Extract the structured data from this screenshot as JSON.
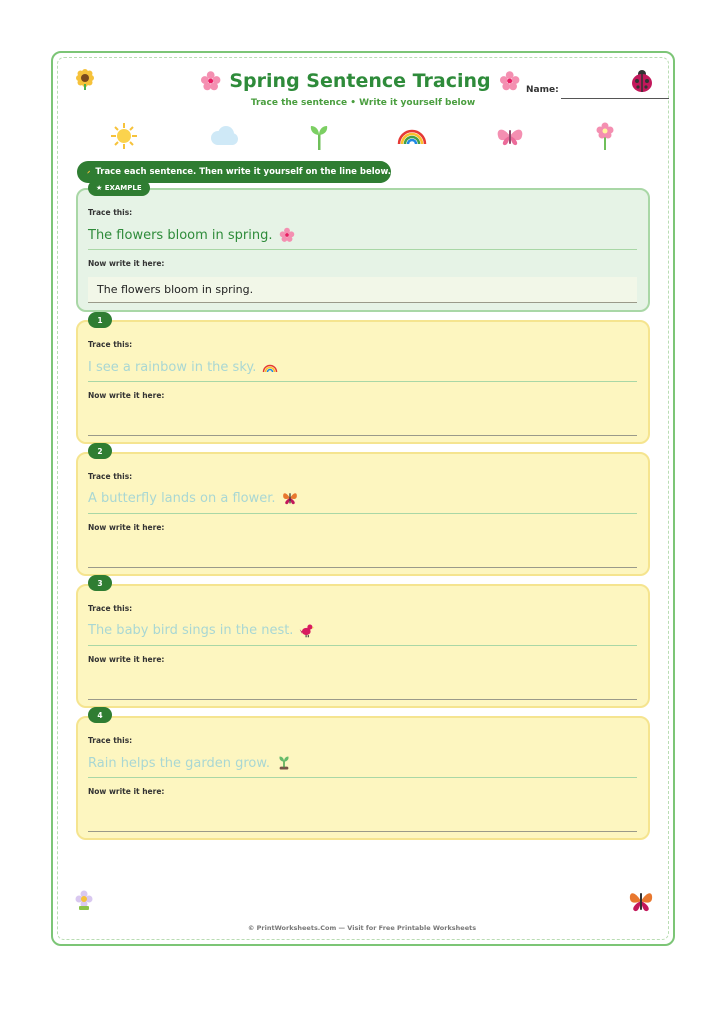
{
  "header": {
    "title": "Spring Sentence Tracing",
    "subtitle": "Trace the sentence • Write it yourself below",
    "name_label": "Name:"
  },
  "decorations": [
    "sun-icon",
    "cloud-icon",
    "sprout-icon",
    "rainbow-icon",
    "butterfly-icon",
    "flower-icon"
  ],
  "instructions": "Trace each sentence. Then write it yourself on the line below.",
  "example": {
    "badge": "★ EXAMPLE",
    "trace_label": "Trace this:",
    "sentence": "The flowers bloom in spring.",
    "write_label": "Now write it here:",
    "written": "The flowers bloom in spring."
  },
  "items": [
    {
      "number": "1",
      "trace_label": "Trace this:",
      "sentence": "I see a rainbow in the sky.",
      "icon": "rainbow-icon",
      "write_label": "Now write it here:"
    },
    {
      "number": "2",
      "trace_label": "Trace this:",
      "sentence": "A butterfly lands on a flower.",
      "icon": "butterfly-icon",
      "write_label": "Now write it here:"
    },
    {
      "number": "3",
      "trace_label": "Trace this:",
      "sentence": "The baby bird sings in the nest.",
      "icon": "bird-icon",
      "write_label": "Now write it here:"
    },
    {
      "number": "4",
      "trace_label": "Trace this:",
      "sentence": "Rain helps the garden grow.",
      "icon": "seedling-icon",
      "write_label": "Now write it here:"
    }
  ],
  "footer": "© PrintWorksheets.Com — Visit for Free Printable Worksheets",
  "colors": {
    "brand_green": "#2f7d32",
    "title_green": "#2e8b3a",
    "example_bg": "#e6f3e6",
    "practice_bg": "#fdf6c0",
    "trace_faint": "#a9d7d3"
  }
}
